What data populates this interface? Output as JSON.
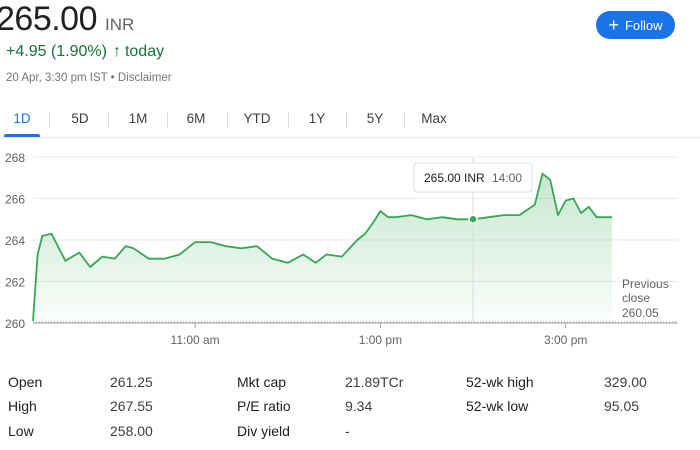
{
  "quote": {
    "price": "265.00",
    "currency": "INR",
    "change": "+4.95 (1.90%)",
    "change_arrow": "↑",
    "change_period": "today",
    "timestamp": "20 Apr, 3:30 pm IST",
    "separator": "•",
    "disclaimer": "Disclaimer"
  },
  "follow_button": {
    "icon": "plus-icon",
    "icon_glyph": "+",
    "label": "Follow",
    "color": "#1a73e8"
  },
  "tabs": [
    {
      "label": "1D",
      "active": true
    },
    {
      "label": "5D"
    },
    {
      "label": "1M"
    },
    {
      "label": "6M"
    },
    {
      "label": "YTD"
    },
    {
      "label": "1Y"
    },
    {
      "label": "5Y"
    },
    {
      "label": "Max"
    }
  ],
  "chart_data": {
    "type": "area",
    "ylim": [
      260,
      268
    ],
    "yticks": [
      "268",
      "266",
      "264",
      "262",
      "260"
    ],
    "xticks": [
      "11:00 am",
      "1:00 pm",
      "3:00 pm"
    ],
    "grid": true,
    "line_color": "#34a853",
    "previous_close": {
      "label_line1": "Previous",
      "label_line2": "close",
      "value": "260.05"
    },
    "tooltip": {
      "price": "265.00 INR",
      "time": "14:00"
    },
    "x": [
      "9:15",
      "9:18",
      "9:21",
      "9:27",
      "9:36",
      "9:45",
      "9:52",
      "10:00",
      "10:08",
      "10:15",
      "10:20",
      "10:30",
      "10:40",
      "10:50",
      "11:00",
      "11:10",
      "11:20",
      "11:30",
      "11:40",
      "11:50",
      "12:00",
      "12:10",
      "12:18",
      "12:25",
      "12:35",
      "12:45",
      "12:50",
      "12:55",
      "13:00",
      "13:05",
      "13:10",
      "13:20",
      "13:30",
      "13:40",
      "13:50",
      "14:00",
      "14:10",
      "14:20",
      "14:30",
      "14:40",
      "14:45",
      "14:50",
      "14:55",
      "15:00",
      "15:05",
      "15:10",
      "15:15",
      "15:20",
      "15:25",
      "15:30"
    ],
    "values": [
      260.1,
      263.3,
      264.2,
      264.3,
      263.0,
      263.4,
      262.7,
      263.2,
      263.1,
      263.7,
      263.6,
      263.1,
      263.1,
      263.3,
      263.9,
      263.9,
      263.7,
      263.6,
      263.7,
      263.1,
      262.9,
      263.3,
      262.9,
      263.3,
      263.2,
      264.0,
      264.3,
      264.8,
      265.4,
      265.1,
      265.1,
      265.2,
      265.0,
      265.1,
      265.0,
      265.0,
      265.1,
      265.2,
      265.2,
      265.7,
      267.2,
      266.9,
      265.2,
      265.9,
      266.0,
      265.3,
      265.6,
      265.1,
      265.1,
      265.1
    ]
  },
  "stats": [
    {
      "label": "Open",
      "value": "261.25"
    },
    {
      "label": "High",
      "value": "267.55"
    },
    {
      "label": "Low",
      "value": "258.00"
    },
    {
      "label": "Mkt cap",
      "value": "21.89TCr"
    },
    {
      "label": "P/E ratio",
      "value": "9.34"
    },
    {
      "label": "Div yield",
      "value": "-"
    },
    {
      "label": "52-wk high",
      "value": "329.00"
    },
    {
      "label": "52-wk low",
      "value": "95.05"
    }
  ]
}
